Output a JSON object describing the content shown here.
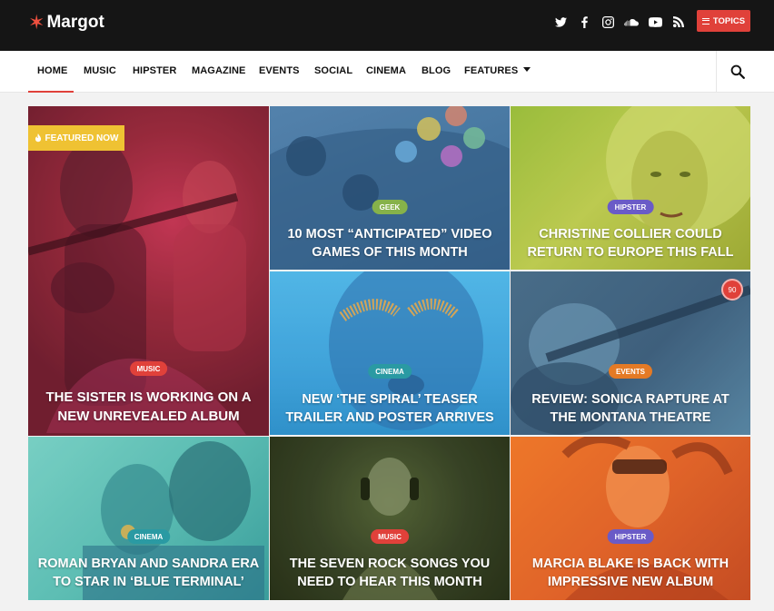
{
  "header": {
    "logo_text": "Margot",
    "social_icons": [
      "twitter-icon",
      "facebook-icon",
      "instagram-icon",
      "soundcloud-icon",
      "youtube-icon",
      "rss-icon"
    ],
    "topics_label": "TOPICS"
  },
  "nav": {
    "items": [
      "HOME",
      "MUSIC",
      "HIPSTER",
      "MAGAZINE",
      "EVENTS",
      "SOCIAL",
      "CINEMA",
      "BLOG",
      "FEATURES"
    ],
    "active": "HOME"
  },
  "featured_label": "FEATURED NOW",
  "tiles": [
    {
      "category": "MUSIC",
      "title": "THE SISTER IS WORKING ON A NEW UNREVEALED ALBUM",
      "badge_color": "#e0413a"
    },
    {
      "category": "GEEK",
      "title": "10 MOST “ANTICIPATED” VIDEO GAMES OF THIS MONTH",
      "badge_color": "#86b24a"
    },
    {
      "category": "HIPSTER",
      "title": "CHRISTINE COLLIER COULD RETURN TO EUROPE THIS FALL",
      "badge_color": "#6a5bc7"
    },
    {
      "category": "CINEMA",
      "title": "NEW ‘THE SPIRAL’ TEASER TRAILER AND POSTER ARRIVES",
      "badge_color": "#2a9aa3"
    },
    {
      "category": "EVENTS",
      "title": "REVIEW: SONICA RAPTURE AT THE MONTANA THEATRE",
      "badge_color": "#e47a25",
      "score": "90"
    },
    {
      "category": "CINEMA",
      "title": "ROMAN BRYAN AND SANDRA ERA TO STAR IN ‘BLUE TERMINAL’",
      "badge_color": "#2a9aa3"
    },
    {
      "category": "MUSIC",
      "title": "THE SEVEN ROCK SONGS YOU NEED TO HEAR THIS MONTH",
      "badge_color": "#e0413a"
    },
    {
      "category": "HIPSTER",
      "title": "MARCIA BLAKE IS BACK WITH IMPRESSIVE NEW ALBUM",
      "badge_color": "#6a5bc7"
    }
  ],
  "colors": {
    "accent": "#e0413a",
    "header_bg": "#151515",
    "featured_bg": "#efc233"
  }
}
